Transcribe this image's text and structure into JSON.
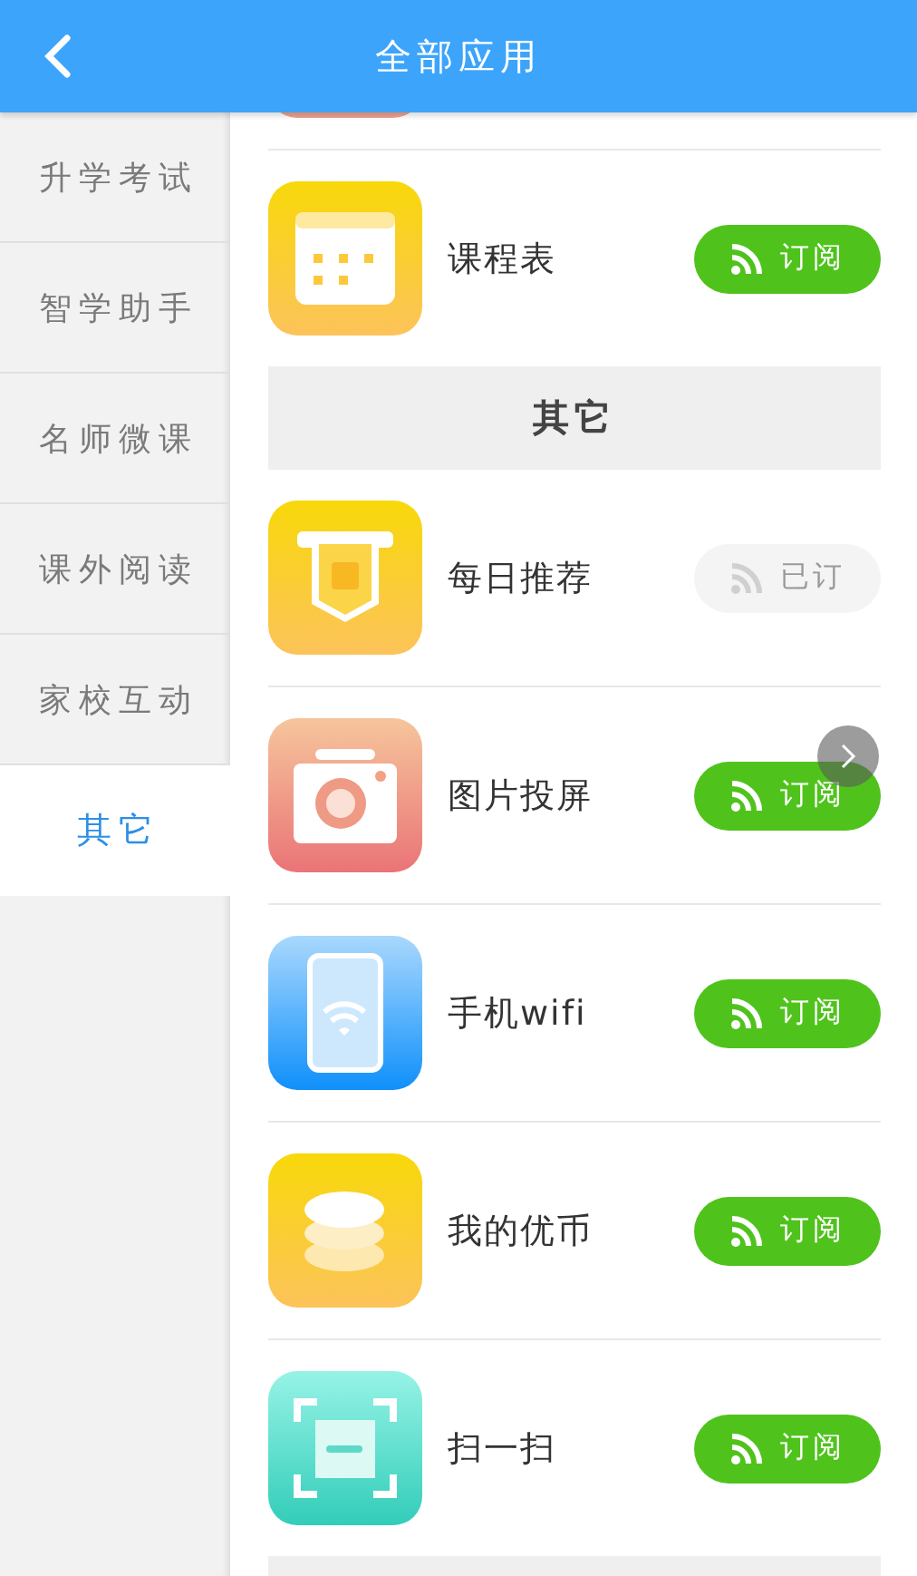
{
  "header": {
    "title": "全部应用"
  },
  "sidebar": [
    {
      "label": "升学考试",
      "selected": false
    },
    {
      "label": "智学助手",
      "selected": false
    },
    {
      "label": "名师微课",
      "selected": false
    },
    {
      "label": "课外阅读",
      "selected": false
    },
    {
      "label": "家校互动",
      "selected": false
    },
    {
      "label": "其它",
      "selected": true
    }
  ],
  "groups": [
    {
      "apps": [
        {
          "kind": "cropped"
        },
        {
          "kind": "calendar",
          "name": "课程表",
          "subscribed": false,
          "button": "订阅"
        }
      ]
    },
    {
      "title": "其它",
      "apps": [
        {
          "kind": "ticket",
          "name": "每日推荐",
          "subscribed": true,
          "button": "已订"
        },
        {
          "kind": "camera",
          "name": "图片投屏",
          "subscribed": false,
          "button": "订阅"
        },
        {
          "kind": "phone",
          "name": "手机wifi",
          "subscribed": false,
          "button": "订阅"
        },
        {
          "kind": "coins",
          "name": "我的优币",
          "subscribed": false,
          "button": "订阅"
        },
        {
          "kind": "scan",
          "name": "扫一扫",
          "subscribed": false,
          "button": "订阅"
        }
      ]
    }
  ],
  "trailing_header": true,
  "floating_button": true
}
